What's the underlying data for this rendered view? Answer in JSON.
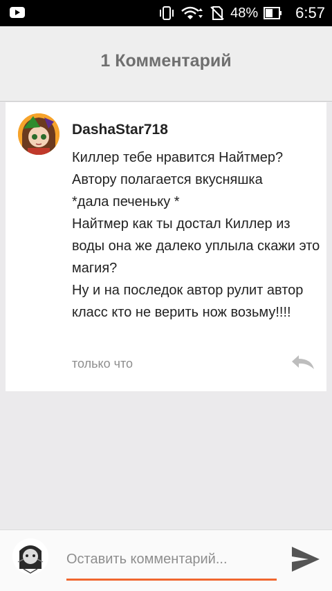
{
  "status_bar": {
    "battery": "48%",
    "time": "6:57",
    "icons": [
      "youtube-icon",
      "vibrate-icon",
      "wifi-icon",
      "no-sim-icon",
      "battery-icon"
    ]
  },
  "header": {
    "title": "1 Комментарий"
  },
  "comment": {
    "author": "DashaStar718",
    "text": "Киллер тебе нравится Найтмер?\nАвтору полагается вкусняшка\n*дала печеньку *\nНайтмер как ты достал Киллер из воды она же далеко уплыла скажи это магия?\nНу и на последок автор рулит автор класс кто не верить нож возьму!!!!",
    "time": "только что",
    "reply_icon": "reply-icon"
  },
  "composer": {
    "placeholder": "Оставить комментарий...",
    "value": "",
    "send_icon": "send-icon"
  },
  "colors": {
    "accent": "#f0662e",
    "background": "#ebeaec",
    "title": "#6f6f6f"
  }
}
